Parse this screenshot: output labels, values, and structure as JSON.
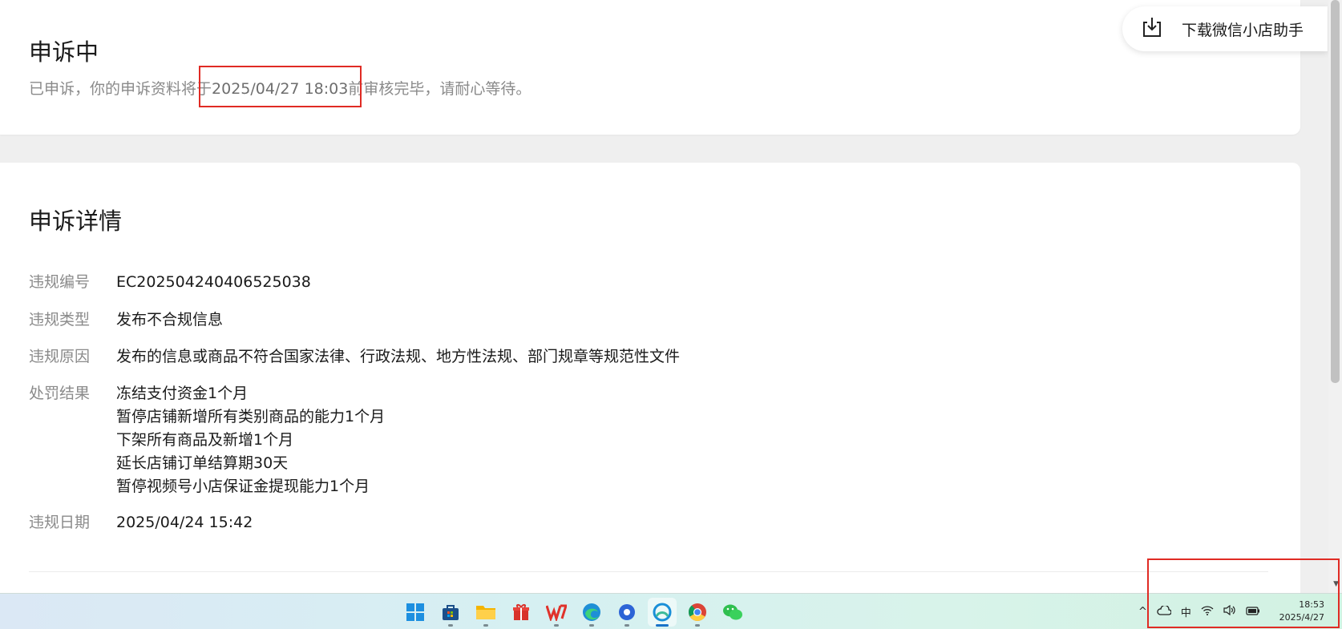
{
  "status": {
    "title": "申诉中",
    "desc_prefix": "已申诉，你的申诉资料将于",
    "desc_date": "2025/04/27 18:03",
    "desc_suffix": "前审核完毕，请耐心等待。"
  },
  "download": {
    "icon": "download-icon",
    "label": "下载微信小店助手"
  },
  "detail": {
    "title": "申诉详情",
    "rows": [
      {
        "label": "违规编号",
        "value": "EC202504240406525038"
      },
      {
        "label": "违规类型",
        "value": "发布不合规信息"
      },
      {
        "label": "违规原因",
        "value": "发布的信息或商品不符合国家法律、行政法规、地方性法规、部门规章等规范性文件"
      }
    ],
    "penalty": {
      "label": "处罚结果",
      "lines": [
        "冻结支付资金1个月",
        "暂停店铺新增所有类别商品的能力1个月",
        "下架所有商品及新增1个月",
        "延长店铺订单结算期30天",
        "暂停视频号小店保证金提现能力1个月"
      ]
    },
    "date": {
      "label": "违规日期",
      "value": "2025/04/24 15:42"
    }
  },
  "taskbar": {
    "apps": [
      "windows-start-icon",
      "microsoft-store-icon",
      "file-explorer-icon",
      "gift-icon",
      "wps-icon",
      "edge-icon",
      "app-circle-icon",
      "browser-active-icon",
      "chrome-icon",
      "wechat-icon"
    ],
    "tray": {
      "chevron": "^",
      "ime": "中"
    },
    "clock": {
      "time": "18:53",
      "date": "2025/4/27"
    }
  },
  "colors": {
    "highlight_box": "#e02b24",
    "accent": "#1a73c8"
  }
}
